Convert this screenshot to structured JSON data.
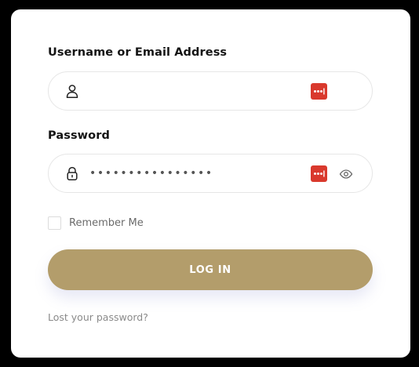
{
  "form": {
    "username_label": "Username or Email Address",
    "username_value": "",
    "password_label": "Password",
    "password_value": "••••••••••••••••",
    "remember_label": "Remember Me",
    "remember_checked": false,
    "login_label": "LOG IN",
    "lost_password_label": "Lost your password?"
  },
  "icons": {
    "username_icon": "user-icon",
    "password_icon": "lock-icon",
    "password_manager_icon": "password-manager-icon",
    "show_password_icon": "eye-icon"
  },
  "colors": {
    "button": "#b39d6b",
    "password_manager_badge": "#d9392d",
    "background": "#000000",
    "card": "#ffffff"
  }
}
